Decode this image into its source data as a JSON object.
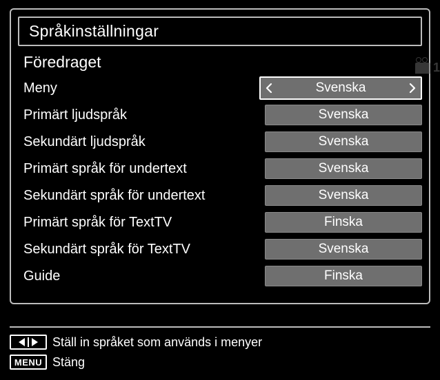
{
  "title": "Språkinställningar",
  "section": "Föredraget",
  "cornerBadge": "1",
  "rows": [
    {
      "label": "Meny",
      "value": "Svenska",
      "focused": true
    },
    {
      "label": "Primärt ljudspråk",
      "value": "Svenska",
      "focused": false
    },
    {
      "label": "Sekundärt ljudspråk",
      "value": "Svenska",
      "focused": false
    },
    {
      "label": "Primärt språk för undertext",
      "value": "Svenska",
      "focused": false
    },
    {
      "label": "Sekundärt språk för undertext",
      "value": "Svenska",
      "focused": false
    },
    {
      "label": "Primärt språk för TextTV",
      "value": "Finska",
      "focused": false
    },
    {
      "label": "Sekundärt språk för TextTV",
      "value": "Svenska",
      "focused": false
    },
    {
      "label": "Guide",
      "value": "Finska",
      "focused": false
    }
  ],
  "footer": {
    "hint": "Ställ in språket som används i menyer",
    "menuLabel": "MENU",
    "menuAction": "Stäng"
  }
}
